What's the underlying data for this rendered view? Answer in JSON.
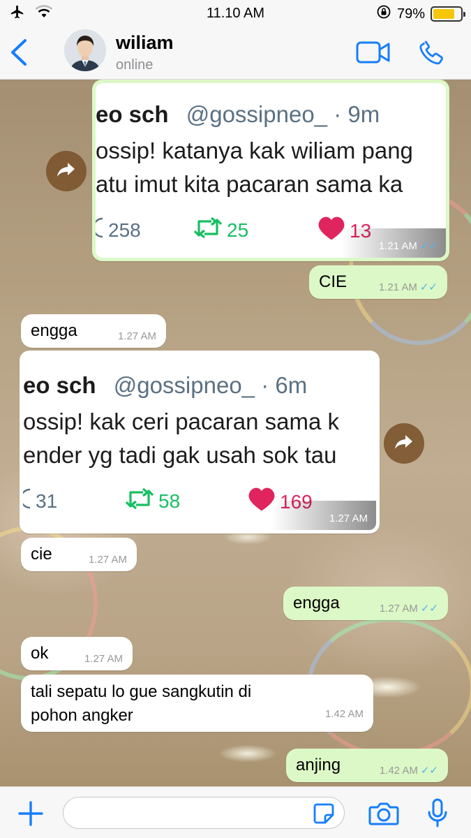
{
  "status_bar": {
    "time": "11.10 AM",
    "battery": "79%",
    "battery_level": 0.79
  },
  "header": {
    "contact_name": "wiliam",
    "contact_status": "online"
  },
  "messages": [
    {
      "type": "image",
      "direction": "in",
      "time": "1.21 AM",
      "tweet": {
        "name": "eo sch",
        "handle": "@gossipneo_",
        "age": "· 9m",
        "line1": "ossip! katanya kak wiliam pang",
        "line2": "atu imut kita pacaran sama ka",
        "replies": "258",
        "retweets": "25",
        "likes": "13"
      }
    },
    {
      "type": "text",
      "direction": "out",
      "text": "CIE",
      "time": "1.21 AM"
    },
    {
      "type": "text",
      "direction": "in",
      "text": "engga",
      "time": "1.27 AM"
    },
    {
      "type": "image",
      "direction": "in",
      "time": "1.27 AM",
      "tweet": {
        "name": "eo sch",
        "handle": "@gossipneo_",
        "age": "· 6m",
        "line1": "ossip! kak ceri pacaran sama k",
        "line2": "ender yg tadi gak usah sok tau",
        "replies": "31",
        "retweets": "58",
        "likes": "169"
      }
    },
    {
      "type": "text",
      "direction": "in",
      "text": "cie",
      "time": "1.27 AM"
    },
    {
      "type": "text",
      "direction": "out",
      "text": "engga",
      "time": "1.27 AM"
    },
    {
      "type": "text",
      "direction": "in",
      "text": "ok",
      "time": "1.27 AM"
    },
    {
      "type": "text",
      "direction": "in",
      "text_line1": "tali sepatu lo gue sangkutin di",
      "text_line2": "pohon angker",
      "time": "1.42 AM"
    },
    {
      "type": "text",
      "direction": "out",
      "text": "anjing",
      "time": "1.42 AM"
    }
  ],
  "input": {
    "placeholder": ""
  },
  "colors": {
    "accent": "#157efb",
    "outgoing_bubble": "#dcf8c6",
    "incoming_bubble": "#ffffff",
    "read_ticks": "#4fb6ec",
    "retweet": "#17bf63",
    "like": "#e0245e"
  },
  "icons": [
    "airplane-icon",
    "wifi-icon",
    "orientation-lock-icon",
    "battery-icon",
    "back-chevron-icon",
    "video-call-icon",
    "phone-icon",
    "forward-icon",
    "reply-icon",
    "retweet-icon",
    "heart-icon",
    "double-tick-icon",
    "plus-icon",
    "sticker-icon",
    "camera-icon",
    "microphone-icon"
  ]
}
